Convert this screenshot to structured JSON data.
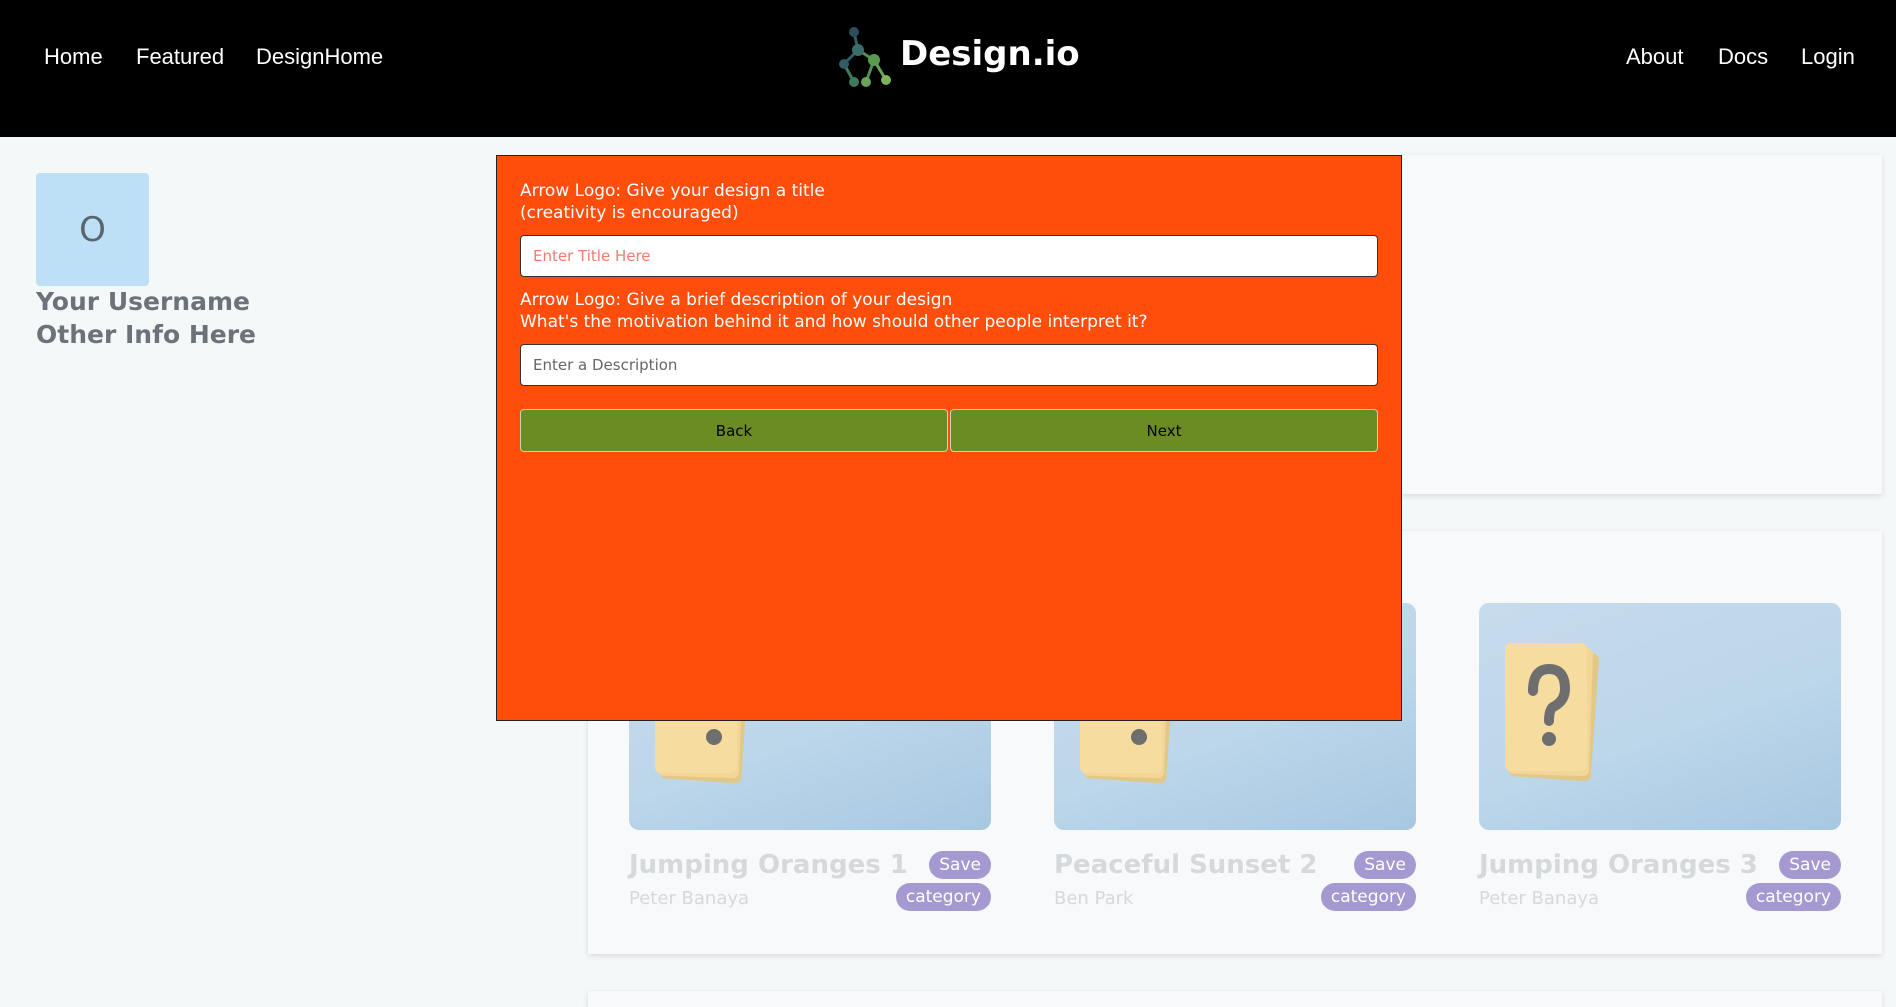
{
  "nav": {
    "left_links": [
      "Home",
      "Featured",
      "DesignHome"
    ],
    "brand": "Design.io",
    "right_links": [
      "About",
      "Docs",
      "Login"
    ]
  },
  "profile": {
    "avatar_text": "O",
    "username": "Your Username",
    "info": "Other Info Here"
  },
  "cards": [
    {
      "title": "Jumping Oranges 1",
      "author": "Peter Banaya",
      "save_label": "Save",
      "category_label": "category",
      "icon": "exclamation-cards-icon"
    },
    {
      "title": "Peaceful Sunset 2",
      "author": "Ben Park",
      "save_label": "Save",
      "category_label": "category",
      "icon": "exclamation-cards-icon"
    },
    {
      "title": "Jumping Oranges 3",
      "author": "Peter Banaya",
      "save_label": "Save",
      "category_label": "category",
      "icon": "question-cards-icon"
    }
  ],
  "modal": {
    "title_prompt_line1": "Arrow Logo: Give your design a title",
    "title_prompt_line2": "(creativity is encouraged)",
    "title_placeholder": "Enter Title Here",
    "desc_prompt_line1": "Arrow Logo: Give a brief description of your design",
    "desc_prompt_line2": "What's the motivation behind it and how should other people interpret it?",
    "desc_placeholder": "Enter a Description",
    "back_label": "Back",
    "next_label": "Next"
  },
  "colors": {
    "navbar": "#000000",
    "modal_bg": "#ff4d0c",
    "button_bg": "#6b8c22",
    "pill_bg": "#a699d1",
    "avatar_bg": "#bde0f6"
  }
}
